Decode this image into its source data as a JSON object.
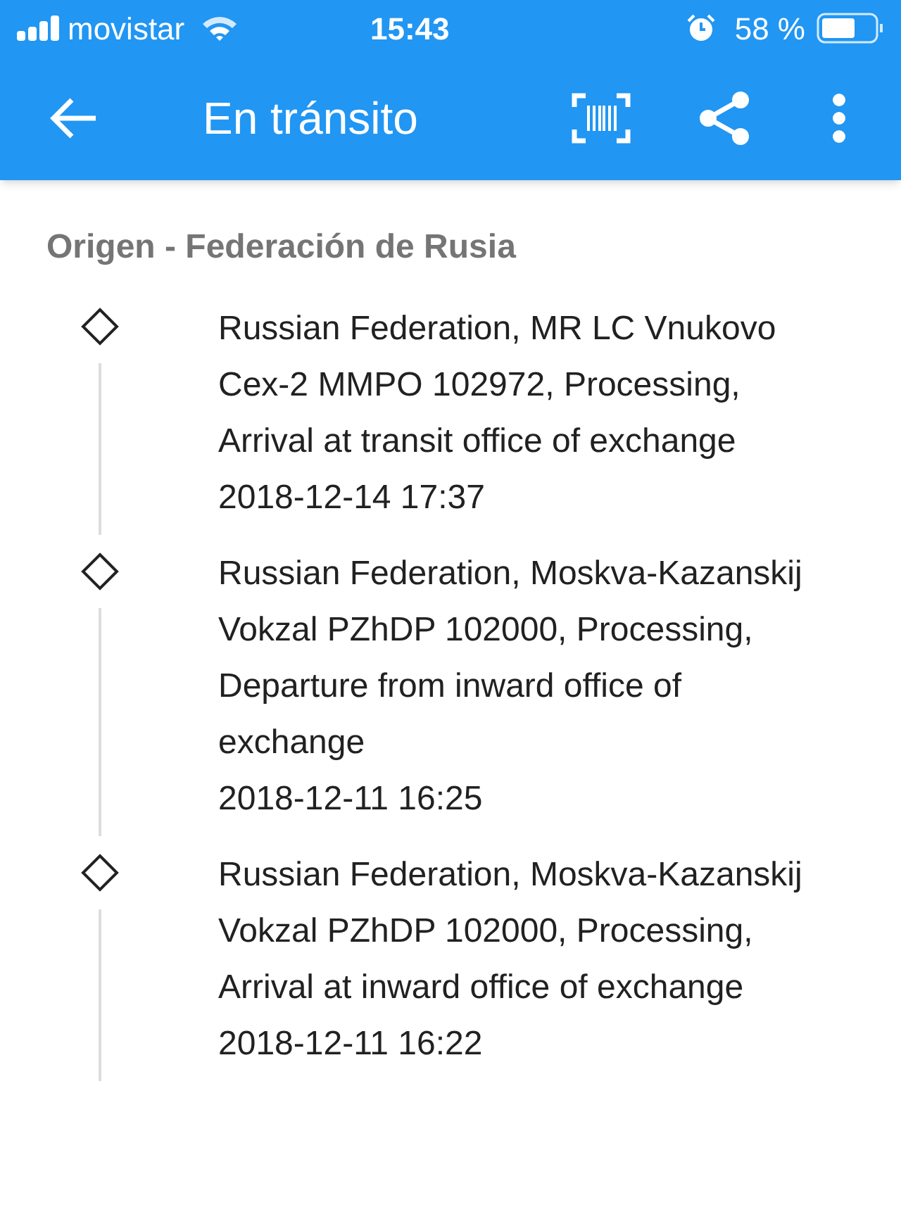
{
  "status_bar": {
    "carrier": "movistar",
    "time": "15:43",
    "battery": "58 %"
  },
  "app_bar": {
    "title": "En tránsito"
  },
  "section": {
    "title": "Origen - Federación de Rusia"
  },
  "events": [
    {
      "description": "Russian Federation, MR LC Vnukovo Cex-2 MMPO 102972, Processing, Arrival at transit office of exchange",
      "datetime": "2018-12-14 17:37"
    },
    {
      "description": "Russian Federation, Moskva-Kazanskij Vokzal PZhDP 102000, Processing, Departure from inward office of exchange",
      "datetime": "2018-12-11 16:25"
    },
    {
      "description": "Russian Federation, Moskva-Kazanskij Vokzal PZhDP 102000, Processing, Arrival at inward office of exchange",
      "datetime": "2018-12-11 16:22"
    }
  ]
}
